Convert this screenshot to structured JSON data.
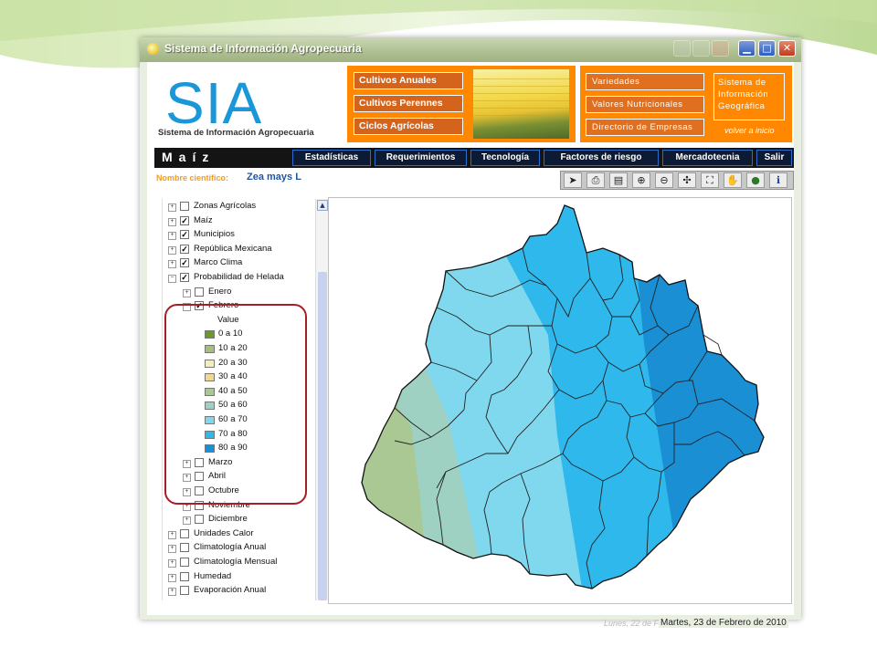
{
  "window": {
    "title": "Sistema de Información Agropecuaria"
  },
  "header": {
    "logo": "SIA",
    "subtitle": "Sistema de Información Agropecuaria",
    "menu_left": [
      "Cultivos Anuales",
      "Cultivos Perennes",
      "Ciclos Agrícolas"
    ],
    "menu_right": [
      "Variedades",
      "Valores Nutricionales",
      "Directorio de Empresas"
    ],
    "geo_box": [
      "Sistema de",
      "Información",
      "Geográfica"
    ],
    "volver": "volver a inicio"
  },
  "navbar": {
    "crop": "Maíz",
    "buttons": [
      "Estadísticas",
      "Requerimientos",
      "Tecnología",
      "Factores de riesgo",
      "Mercadotecnia",
      "Salir"
    ]
  },
  "scientific": {
    "label": "Nombre científico:",
    "value": "Zea mays L"
  },
  "toolbar": {
    "icons": [
      "pointer-icon",
      "print-icon",
      "document-icon",
      "zoom-in-icon",
      "zoom-out-icon",
      "zoom-extent-icon",
      "full-extent-icon",
      "pan-hand-icon",
      "globe-icon",
      "info-icon"
    ]
  },
  "tree": {
    "items": [
      {
        "label": "Zonas Agrícolas",
        "checked": false,
        "expanded": false,
        "level": 0
      },
      {
        "label": "Maíz",
        "checked": true,
        "expanded": false,
        "level": 0
      },
      {
        "label": "Municipios",
        "checked": true,
        "expanded": false,
        "level": 0
      },
      {
        "label": "República Mexicana",
        "checked": true,
        "expanded": false,
        "level": 0
      },
      {
        "label": "Marco Clima",
        "checked": true,
        "expanded": false,
        "level": 0
      },
      {
        "label": "Probabilidad de Helada",
        "checked": true,
        "expanded": true,
        "level": 0
      },
      {
        "label": "Enero",
        "checked": false,
        "expanded": false,
        "level": 1
      },
      {
        "label": "Febrero",
        "checked": true,
        "expanded": true,
        "level": 1
      }
    ],
    "legend_title": "Value",
    "legend": [
      {
        "label": "0 a 10",
        "color": "#6a9a28"
      },
      {
        "label": "10 a 20",
        "color": "#a8bf7c"
      },
      {
        "label": "20 a 30",
        "color": "#f3efb5"
      },
      {
        "label": "30 a 40",
        "color": "#f0d890"
      },
      {
        "label": "40 a 50",
        "color": "#a9c894"
      },
      {
        "label": "50 a 60",
        "color": "#9ed1c1"
      },
      {
        "label": "60 a 70",
        "color": "#7fd8ee"
      },
      {
        "label": "70 a 80",
        "color": "#2fb8ec"
      },
      {
        "label": "80 a 90",
        "color": "#1a8fd4"
      }
    ],
    "items_after": [
      {
        "label": "Marzo",
        "checked": false,
        "level": 1
      },
      {
        "label": "Abril",
        "checked": false,
        "level": 1
      },
      {
        "label": "Octubre",
        "checked": false,
        "level": 1
      },
      {
        "label": "Noviembre",
        "checked": false,
        "level": 1
      },
      {
        "label": "Diciembre",
        "checked": false,
        "level": 1
      },
      {
        "label": "Unidades Calor",
        "checked": false,
        "level": 0
      },
      {
        "label": "Climatología Anual",
        "checked": false,
        "level": 0
      },
      {
        "label": "Climatología Mensual",
        "checked": false,
        "level": 0
      },
      {
        "label": "Humedad",
        "checked": false,
        "level": 0
      },
      {
        "label": "Evaporación Anual",
        "checked": false,
        "level": 0
      }
    ]
  },
  "map": {
    "zone_colors": {
      "zone_50_60": "#9ed1c1",
      "zone_40_50": "#a9c894",
      "zone_60_70": "#7fd8ee",
      "zone_70_80": "#2fb8ec",
      "zone_80_90": "#1a8fd4"
    }
  },
  "status": {
    "ghost": "Lunes, 22 de Febrero de 2010",
    "date": "Martes, 23 de Febrero de 2010"
  }
}
